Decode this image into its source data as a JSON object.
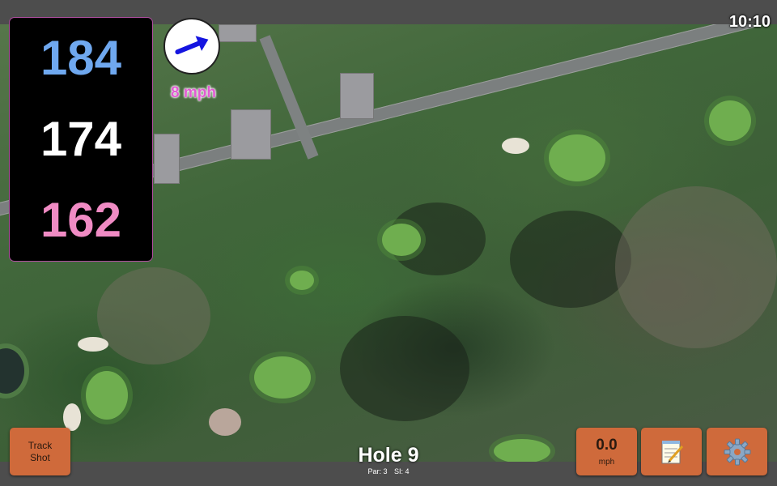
{
  "distances": {
    "back": "184",
    "middle": "174",
    "front": "162"
  },
  "wind": {
    "speed": "8 mph",
    "arrow_icon": "wind-arrow-icon"
  },
  "clock": "10:10",
  "hole": {
    "title": "Hole 9",
    "par": "Par: 3",
    "si": "SI: 4"
  },
  "buttons": {
    "track_shot_line1": "Track",
    "track_shot_line2": "Shot",
    "speed_value": "0.0",
    "speed_unit": "mph",
    "notes_icon": "notepad-icon",
    "settings_icon": "gear-icon"
  },
  "colors": {
    "back": "#6fa8ef",
    "middle": "#ffffff",
    "front": "#f08bc4",
    "button": "#cf6a3b",
    "wind_text": "#e25bd3"
  }
}
